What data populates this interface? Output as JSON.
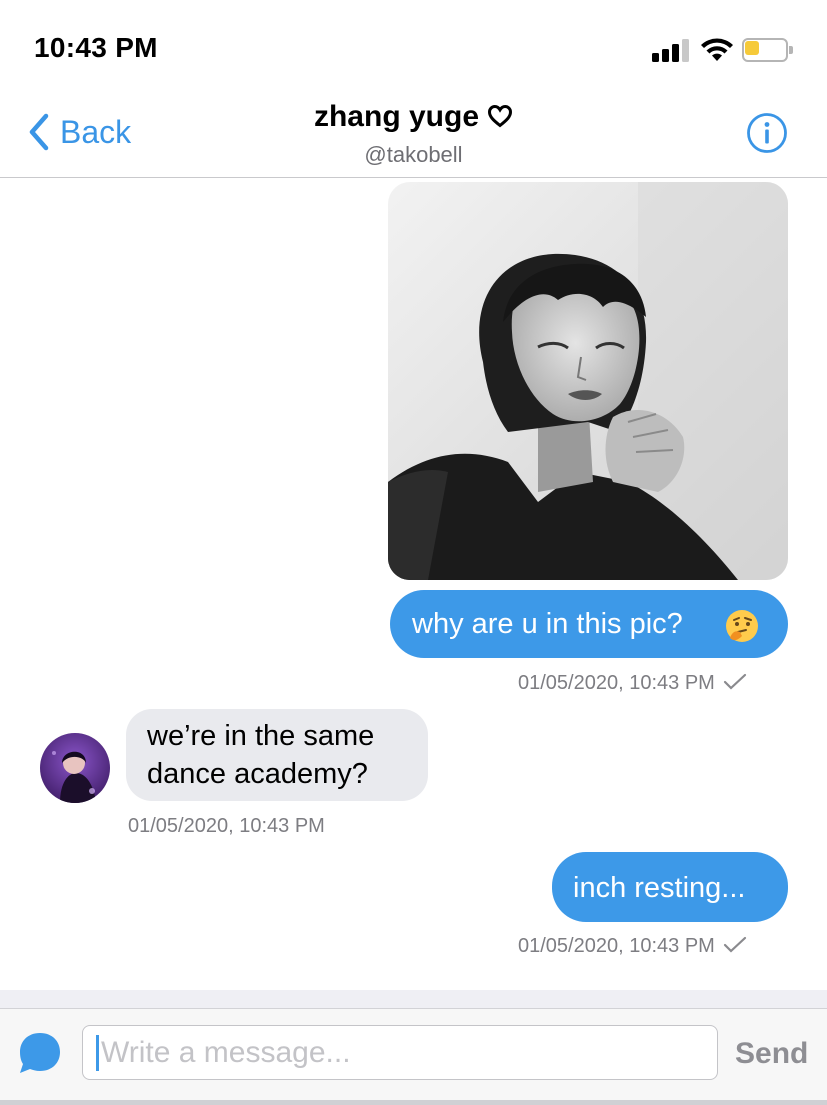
{
  "status_bar": {
    "time": "10:43 PM"
  },
  "nav": {
    "back_label": "Back",
    "title": "zhang yuge",
    "subtitle": "@takobell"
  },
  "messages": [
    {
      "direction": "outgoing",
      "type": "photo"
    },
    {
      "direction": "outgoing",
      "type": "text",
      "text": "why are u in this pic?",
      "emoji": "thinking-face-emoji",
      "timestamp": "01/05/2020, 10:43 PM",
      "read": true
    },
    {
      "direction": "incoming",
      "type": "text",
      "lines": [
        "we’re in the same",
        "dance academy?"
      ],
      "timestamp": "01/05/2020, 10:43 PM"
    },
    {
      "direction": "outgoing",
      "type": "text",
      "text": "inch resting...",
      "timestamp": "01/05/2020, 10:43 PM",
      "read": true
    }
  ],
  "composer": {
    "placeholder": "Write a message...",
    "value": "",
    "send_label": "Send"
  },
  "colors": {
    "accent": "#3a95e6",
    "outgoing_bubble": "#3d99e8",
    "incoming_bubble": "#e9eaee",
    "battery_fill": "#f6ca3a"
  }
}
